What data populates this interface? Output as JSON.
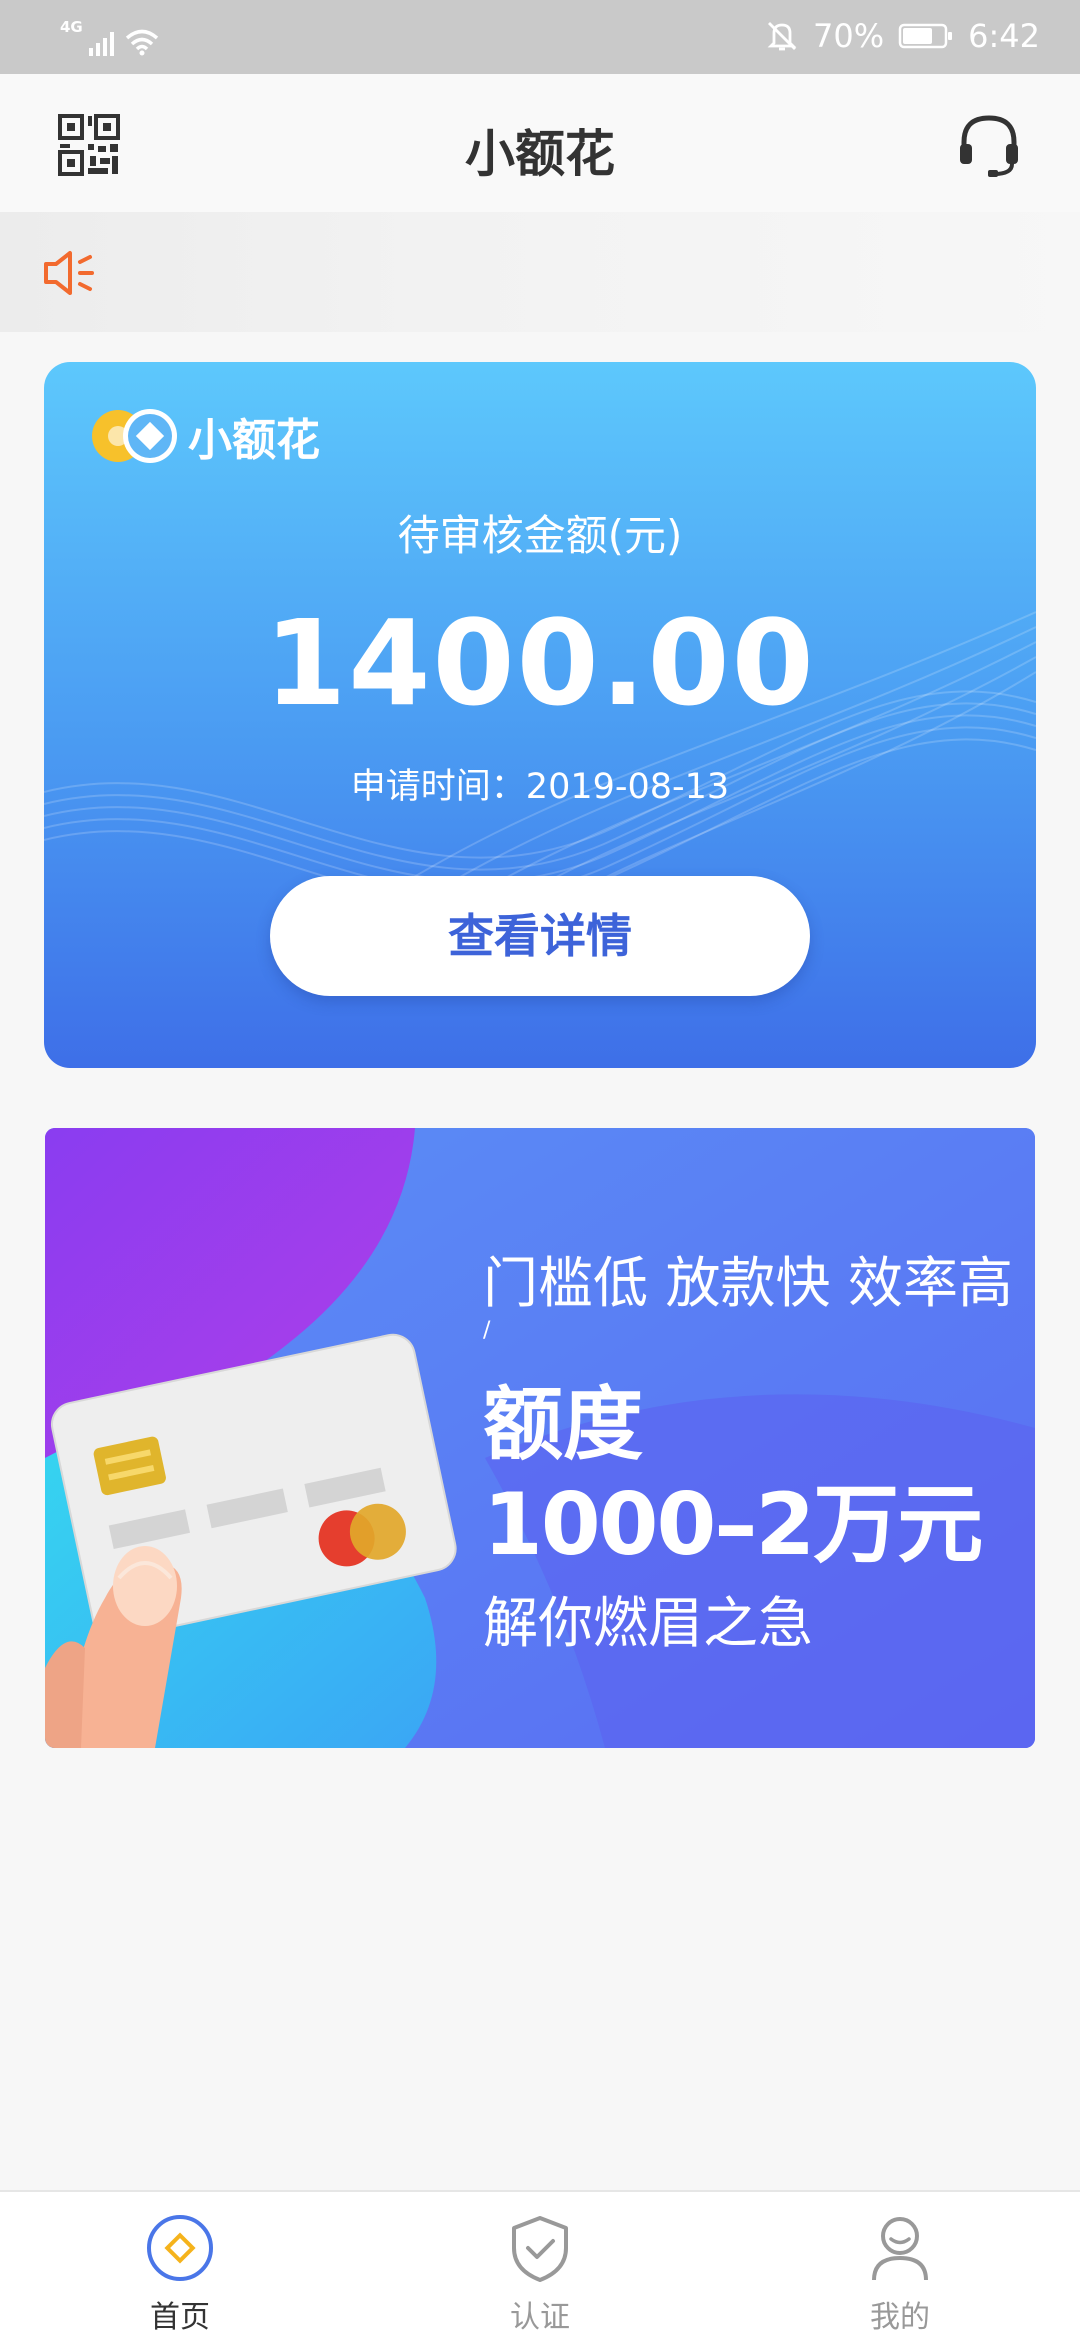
{
  "status_bar": {
    "network": "4G",
    "battery": "70%",
    "time": "6:42"
  },
  "header": {
    "title": "小额花",
    "icons": {
      "left": "qr-code-icon",
      "right": "headset-icon"
    }
  },
  "notice": {
    "icon": "speaker-icon"
  },
  "loan_card": {
    "brand": "小额花",
    "label": "待审核金额(元)",
    "amount": "1400.00",
    "apply_time_label": "申请时间：",
    "apply_date": "2019-08-13",
    "button_label": "查看详情"
  },
  "banner": {
    "line1": "门槛低 放款快 效率高",
    "slash": "/",
    "line2": "额度",
    "line3": "1000–2万元",
    "line4": "解你燃眉之急"
  },
  "tabs": [
    {
      "label": "首页",
      "icon": "home-diamond-icon",
      "active": true
    },
    {
      "label": "认证",
      "icon": "shield-check-icon",
      "active": false
    },
    {
      "label": "我的",
      "icon": "user-icon",
      "active": false
    }
  ],
  "colors": {
    "card_top": "#5dc8fc",
    "card_bottom": "#3e6fe8",
    "button_text": "#3d63d9",
    "notice_icon": "#f26a2e",
    "tab_active": "#4a76e8",
    "tab_inactive": "#999999"
  }
}
